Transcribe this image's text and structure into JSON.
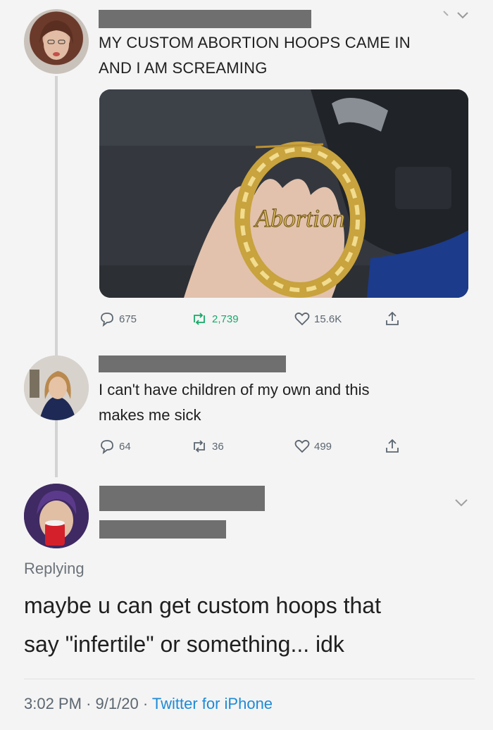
{
  "tweet1": {
    "text_line1": "MY CUSTOM ABORTION HOOPS CAME IN",
    "text_line2": "AND I AM SCREAMING",
    "image_caption": "Abortion",
    "replies": "675",
    "retweets": "2,739",
    "likes": "15.6K"
  },
  "tweet2": {
    "text_line1": "I can't have children of my own and this",
    "text_line2": "makes me sick",
    "replies": "64",
    "retweets": "36",
    "likes": "499"
  },
  "tweet3": {
    "replying": "Replying",
    "text_line1": "maybe u can get custom hoops that",
    "text_line2": "say \"infertile\" or something... idk",
    "time": "3:02 PM",
    "date": "9/1/20",
    "source": "Twitter for iPhone",
    "sep": "·"
  },
  "colors": {
    "retweet": "#17a96a",
    "link": "#1d8ad6",
    "redaction": "#6f6f6f"
  },
  "icons": [
    "reply-icon",
    "retweet-icon",
    "like-icon",
    "share-icon",
    "chevron-down-icon"
  ]
}
